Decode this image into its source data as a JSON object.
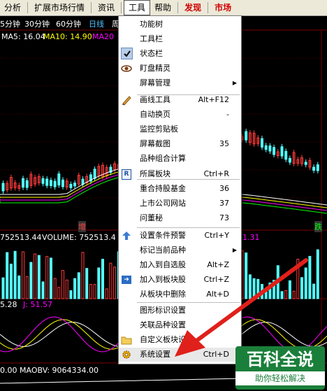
{
  "menubar": {
    "items": [
      {
        "label": "分析",
        "active": false,
        "red": false
      },
      {
        "label": "扩展市场行情",
        "active": false,
        "red": false
      },
      {
        "label": "资讯",
        "active": false,
        "red": false
      },
      {
        "label": "工具",
        "active": true,
        "red": false
      },
      {
        "label": "帮助",
        "active": false,
        "red": false
      },
      {
        "label": "发现",
        "active": false,
        "red": true
      },
      {
        "label": "市场",
        "active": false,
        "red": true
      }
    ]
  },
  "chart": {
    "periods": [
      "5分钟",
      "30分钟",
      "60分钟",
      "日线",
      "周"
    ],
    "ma5": "MA5: 16.04",
    "ma10": "MA10: 14.90",
    "ma20": "MA20",
    "marker_zeng": "增",
    "marker_yue": "跌",
    "volume_left": "752513.44",
    "volume_label": "VOLUME: 752513.4",
    "volume_right": "1.31",
    "kdj_left": "5.28",
    "kdj_j": "J: 51.57",
    "obv_left": "0.00",
    "obv_label": "MAOBV: 9064334.00"
  },
  "menu": {
    "items": [
      {
        "label": "功能树",
        "shortcut": "",
        "icon": "",
        "submenu": false,
        "sep_before": false
      },
      {
        "label": "工具栏",
        "shortcut": "",
        "icon": "",
        "submenu": false,
        "sep_before": false
      },
      {
        "label": "状态栏",
        "shortcut": "",
        "icon": "check-icon",
        "submenu": false,
        "sep_before": false
      },
      {
        "label": "盯盘精灵",
        "shortcut": "",
        "icon": "eye-icon",
        "submenu": false,
        "sep_before": false
      },
      {
        "label": "屏幕管理",
        "shortcut": "",
        "icon": "",
        "submenu": true,
        "sep_before": false
      },
      {
        "label": "画线工具",
        "shortcut": "Alt+F12",
        "icon": "pencil-icon",
        "submenu": false,
        "sep_before": true
      },
      {
        "label": "自动换页",
        "shortcut": "-",
        "icon": "",
        "submenu": false,
        "sep_before": false
      },
      {
        "label": "监控剪贴板",
        "shortcut": "",
        "icon": "",
        "submenu": false,
        "sep_before": false
      },
      {
        "label": "屏幕截图",
        "shortcut": "35",
        "icon": "",
        "submenu": false,
        "sep_before": false
      },
      {
        "label": "品种组合计算",
        "shortcut": "",
        "icon": "",
        "submenu": false,
        "sep_before": false
      },
      {
        "label": "所属板块",
        "shortcut": "Ctrl+R",
        "icon": "r-box-icon",
        "submenu": false,
        "sep_before": true
      },
      {
        "label": "重合持股基金",
        "shortcut": "36",
        "icon": "",
        "submenu": false,
        "sep_before": false
      },
      {
        "label": "上市公司网站",
        "shortcut": "37",
        "icon": "",
        "submenu": false,
        "sep_before": false
      },
      {
        "label": "问董秘",
        "shortcut": "73",
        "icon": "",
        "submenu": false,
        "sep_before": false
      },
      {
        "label": "设置条件预警",
        "shortcut": "Ctrl+Y",
        "icon": "alert-arrow-icon",
        "submenu": false,
        "sep_before": true
      },
      {
        "label": "标记当前品种",
        "shortcut": "",
        "icon": "",
        "submenu": true,
        "sep_before": false
      },
      {
        "label": "加入到自选股",
        "shortcut": "Alt+Z",
        "icon": "",
        "submenu": false,
        "sep_before": false
      },
      {
        "label": "加入到板块股",
        "shortcut": "Ctrl+Z",
        "icon": "add-block-icon",
        "submenu": false,
        "sep_before": false
      },
      {
        "label": "从板块中删除",
        "shortcut": "Alt+D",
        "icon": "",
        "submenu": false,
        "sep_before": false
      },
      {
        "label": "图形标识设置",
        "shortcut": "",
        "icon": "",
        "submenu": false,
        "sep_before": true
      },
      {
        "label": "关联品种设置",
        "shortcut": "",
        "icon": "",
        "submenu": false,
        "sep_before": false
      },
      {
        "label": "自定义板块设置",
        "shortcut": "",
        "icon": "folder-icon",
        "submenu": false,
        "sep_before": false
      },
      {
        "label": "系统设置",
        "shortcut": "Ctrl+D",
        "icon": "gear-icon",
        "submenu": false,
        "sep_before": false
      }
    ]
  },
  "watermark": {
    "title": "百科全说",
    "subtitle": "助你轻松解决"
  },
  "colors": {
    "menu_bg": "#ffffff",
    "menubar_bg": "#ece9d8",
    "chart_bg": "#000000",
    "candle_up": "#ff3b3b",
    "candle_down": "#54ffff",
    "ma_white": "#ffffff",
    "ma_yellow": "#ffff00",
    "ma_magenta": "#ff00ff",
    "ma_green": "#00ff00",
    "arrow_red": "#e0201a",
    "watermark_green": "#1a7f3a"
  }
}
